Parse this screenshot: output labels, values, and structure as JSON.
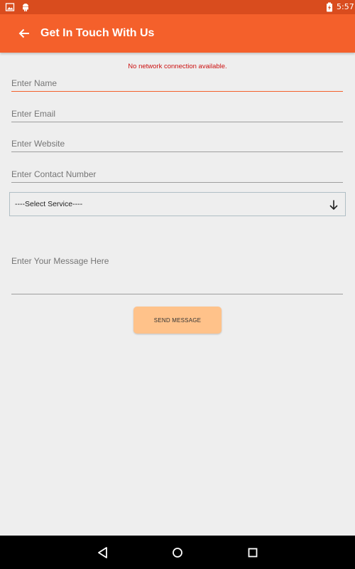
{
  "status_bar": {
    "time": "5:57",
    "icons": [
      "gallery-icon",
      "android-icon",
      "battery-charging-icon"
    ]
  },
  "app_bar": {
    "title": "Get In Touch With Us",
    "back_icon": "arrow-left-icon",
    "color": "#f4602b"
  },
  "notice": {
    "text": "No network connection available.",
    "color": "#cc1111"
  },
  "form": {
    "name_placeholder": "Enter Name",
    "email_placeholder": "Enter Email",
    "website_placeholder": "Enter Website",
    "contact_placeholder": "Enter Contact Number",
    "service_selected": "----Select Service----",
    "message_placeholder": "Enter Your Message Here",
    "submit_label": "SEND MESSAGE",
    "submit_color": "#ffc28a"
  },
  "nav_bar": {
    "icons": [
      "nav-back-icon",
      "nav-home-icon",
      "nav-recents-icon"
    ]
  }
}
